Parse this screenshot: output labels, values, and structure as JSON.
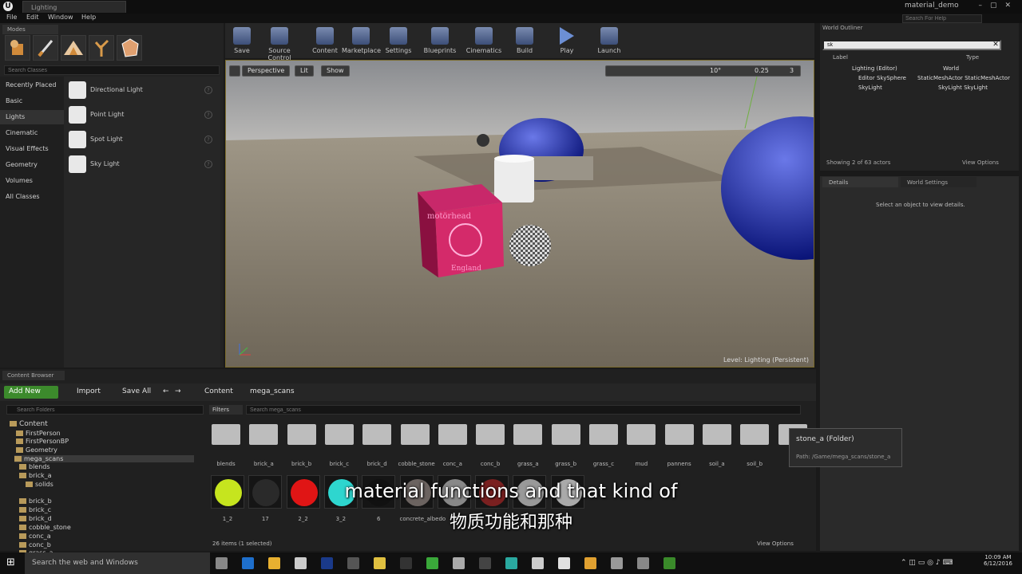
{
  "window": {
    "doc_tab": "Lighting",
    "project_name": "material_demo",
    "help_search_placeholder": "Search For Help",
    "controls": "–▢✕"
  },
  "menu": [
    "File",
    "Edit",
    "Window",
    "Help"
  ],
  "modes": {
    "tab": "Modes",
    "search_placeholder": "Search Classes",
    "categories": [
      "Recently Placed",
      "Basic",
      "Lights",
      "Cinematic",
      "Visual Effects",
      "Geometry",
      "Volumes",
      "All Classes"
    ],
    "active_category": "Lights",
    "items": [
      {
        "label": "Directional Light",
        "icon": "directional-light-icon"
      },
      {
        "label": "Point Light",
        "icon": "point-light-icon"
      },
      {
        "label": "Spot Light",
        "icon": "spot-light-icon"
      },
      {
        "label": "Sky Light",
        "icon": "sky-light-icon"
      }
    ]
  },
  "toolbar": [
    "Save",
    "Source Control",
    "Content",
    "Marketplace",
    "Settings",
    "Blueprints",
    "Cinematics",
    "Build",
    "Play",
    "Launch"
  ],
  "viewport": {
    "perspective": "Perspective",
    "lit": "Lit",
    "show": "Show",
    "angle_snap": "10°",
    "scale_snap": "0.25",
    "cam_speed": "3",
    "level_label": "Level: Lighting (Persistent)",
    "cube_text_top": "motörhead",
    "cube_text_bottom": "England"
  },
  "outliner": {
    "tab": "World Outliner",
    "search_value": "sk",
    "col_label": "Label",
    "col_type": "Type",
    "rows": [
      {
        "label": "Lighting (Editor)",
        "type": "World"
      },
      {
        "label": "Editor SkySphere",
        "type": "StaticMeshActor StaticMeshActor"
      },
      {
        "label": "SkyLight",
        "type": "SkyLight SkyLight"
      }
    ],
    "status": "Showing 2 of 63 actors",
    "view_options": "View Options"
  },
  "details": {
    "tab": "Details",
    "world_settings_tab": "World Settings",
    "message": "Select an object to view details."
  },
  "content_browser": {
    "tab": "Content Browser",
    "add_new": "Add New",
    "import": "Import",
    "save_all": "Save All",
    "path": [
      "Content",
      "mega_scans"
    ],
    "search_folders_placeholder": "Search Folders",
    "filters": "Filters",
    "search_assets_placeholder": "Search mega_scans",
    "tree": [
      {
        "label": "Content",
        "level": 0
      },
      {
        "label": "FirstPerson",
        "level": 1
      },
      {
        "label": "FirstPersonBP",
        "level": 1
      },
      {
        "label": "Geometry",
        "level": 1
      },
      {
        "label": "mega_scans",
        "level": 1,
        "selected": true
      },
      {
        "label": "blends",
        "level": 2
      },
      {
        "label": "brick_a",
        "level": 2
      },
      {
        "label": "solids",
        "level": 3
      },
      {
        "label": "brick_b",
        "level": 2
      },
      {
        "label": "brick_c",
        "level": 2
      },
      {
        "label": "brick_d",
        "level": 2
      },
      {
        "label": "cobble_stone",
        "level": 2
      },
      {
        "label": "conc_a",
        "level": 2
      },
      {
        "label": "conc_b",
        "level": 2
      },
      {
        "label": "grass_a",
        "level": 2
      }
    ],
    "folders": [
      "blends",
      "brick_a",
      "brick_b",
      "brick_c",
      "brick_d",
      "cobble_stone",
      "conc_a",
      "conc_b",
      "grass_a",
      "grass_b",
      "grass_c",
      "mud",
      "pannens",
      "soil_a",
      "soil_b",
      "st"
    ],
    "materials": [
      {
        "label": "1_2",
        "color": "#c6e51e"
      },
      {
        "label": "17",
        "color": "#2a2a2a"
      },
      {
        "label": "2_2",
        "color": "#e01515"
      },
      {
        "label": "3_2",
        "color": "#2ed6cf"
      },
      {
        "label": "6",
        "color": "#111111"
      },
      {
        "label": "concrete_albedo",
        "color": "#6b6360"
      },
      {
        "label": "",
        "color": "#888888"
      },
      {
        "label": "",
        "color": "#7a2020"
      },
      {
        "label": "",
        "color": "#999999"
      },
      {
        "label": "",
        "color": "#aaaaaa"
      }
    ],
    "tooltip_title": "stone_a (Folder)",
    "tooltip_path": "Path: /Game/mega_scans/stone_a",
    "status": "26 items (1 selected)",
    "view_options": "View Options"
  },
  "subtitles": {
    "en": "material functions and that kind of",
    "zh": "物质功能和那种"
  },
  "taskbar": {
    "search": "Search the web and Windows",
    "time": "10:09 AM",
    "date": "6/12/2016"
  }
}
